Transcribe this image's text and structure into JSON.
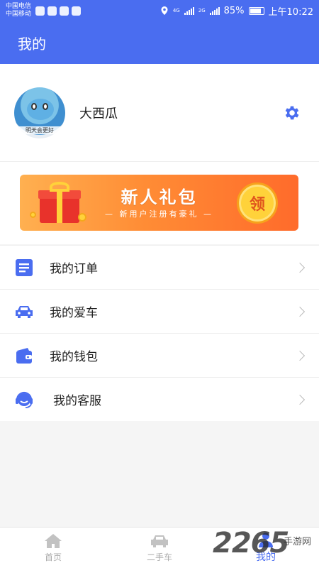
{
  "status_bar": {
    "carrier_1": "中国电信",
    "carrier_2": "中国移动",
    "signal_1_label": "4G",
    "signal_2_label": "2G",
    "battery": "85%",
    "time": "上午10:22"
  },
  "header": {
    "title": "我的"
  },
  "profile": {
    "avatar_caption": "明天会更好",
    "username": "大西瓜",
    "settings_icon": "gear-icon"
  },
  "banner": {
    "title": "新人礼包",
    "subtitle": "— 新用户注册有豪礼 —",
    "claim_label": "领"
  },
  "menu": {
    "items": [
      {
        "label": "我的订单",
        "icon": "order-list-icon"
      },
      {
        "label": "我的爱车",
        "icon": "car-icon"
      },
      {
        "label": "我的钱包",
        "icon": "wallet-icon"
      },
      {
        "label": "我的客服",
        "icon": "headset-icon"
      }
    ]
  },
  "bottom_nav": {
    "items": [
      {
        "label": "首页",
        "icon": "home-icon"
      },
      {
        "label": "二手车",
        "icon": "car-icon"
      },
      {
        "label": "我的",
        "icon": "user-icon"
      }
    ],
    "active_index": 2
  },
  "watermark": {
    "number": "2265",
    "text": "手游网"
  },
  "colors": {
    "primary": "#4a6df0",
    "banner_start": "#ffb050",
    "banner_end": "#ff6b2b",
    "coin": "#ffd23a"
  }
}
